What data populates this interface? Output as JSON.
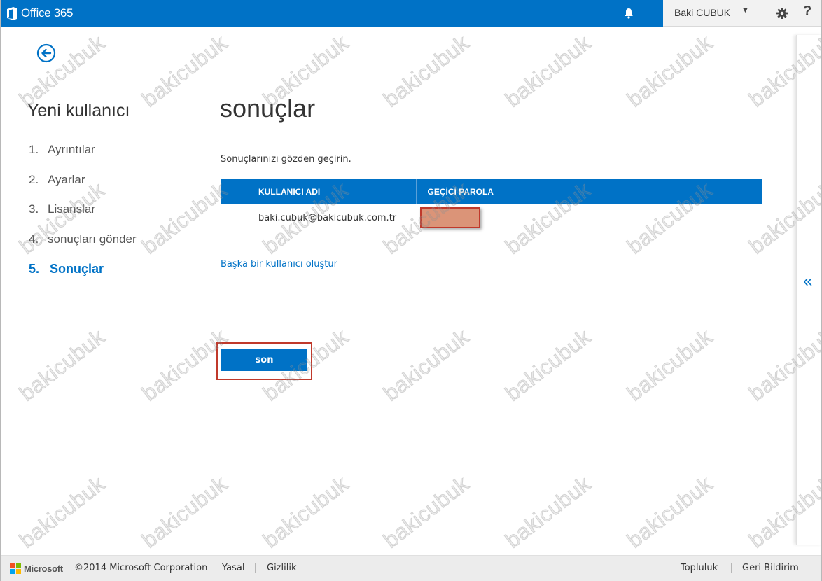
{
  "header": {
    "app_name": "Office 365",
    "user_name": "Baki CUBUK",
    "help_label": "?"
  },
  "wizard": {
    "title": "Yeni kullanıcı",
    "steps": [
      {
        "num": "1.",
        "label": "Ayrıntılar",
        "active": false
      },
      {
        "num": "2.",
        "label": "Ayarlar",
        "active": false
      },
      {
        "num": "3.",
        "label": "Lisanslar",
        "active": false
      },
      {
        "num": "4.",
        "label": "sonuçları gönder",
        "active": false
      },
      {
        "num": "5.",
        "label": "Sonuçlar",
        "active": true
      }
    ]
  },
  "main": {
    "title": "sonuçlar",
    "instructions": "Sonuçlarınızı gözden geçirin.",
    "table": {
      "headers": [
        "KULLANICI ADI",
        "GEÇİCİ PAROLA"
      ],
      "rows": [
        {
          "username": "baki.cubuk@bakicubuk.com.tr",
          "password": ""
        }
      ]
    },
    "create_another_link": "Başka bir kullanıcı oluştur",
    "finish_button": "son"
  },
  "right_panel": {
    "collapse_glyph": "«"
  },
  "footer": {
    "brand": "Microsoft",
    "copyright": "©2014 Microsoft Corporation",
    "legal": "Yasal",
    "privacy": "Gizlilik",
    "community": "Topluluk",
    "feedback": "Geri Bildirim",
    "separator": "|"
  },
  "watermark": "bakicubuk",
  "colors": {
    "accent": "#0072c6",
    "highlight_border": "#c0392b",
    "redaction": "#db9478"
  }
}
